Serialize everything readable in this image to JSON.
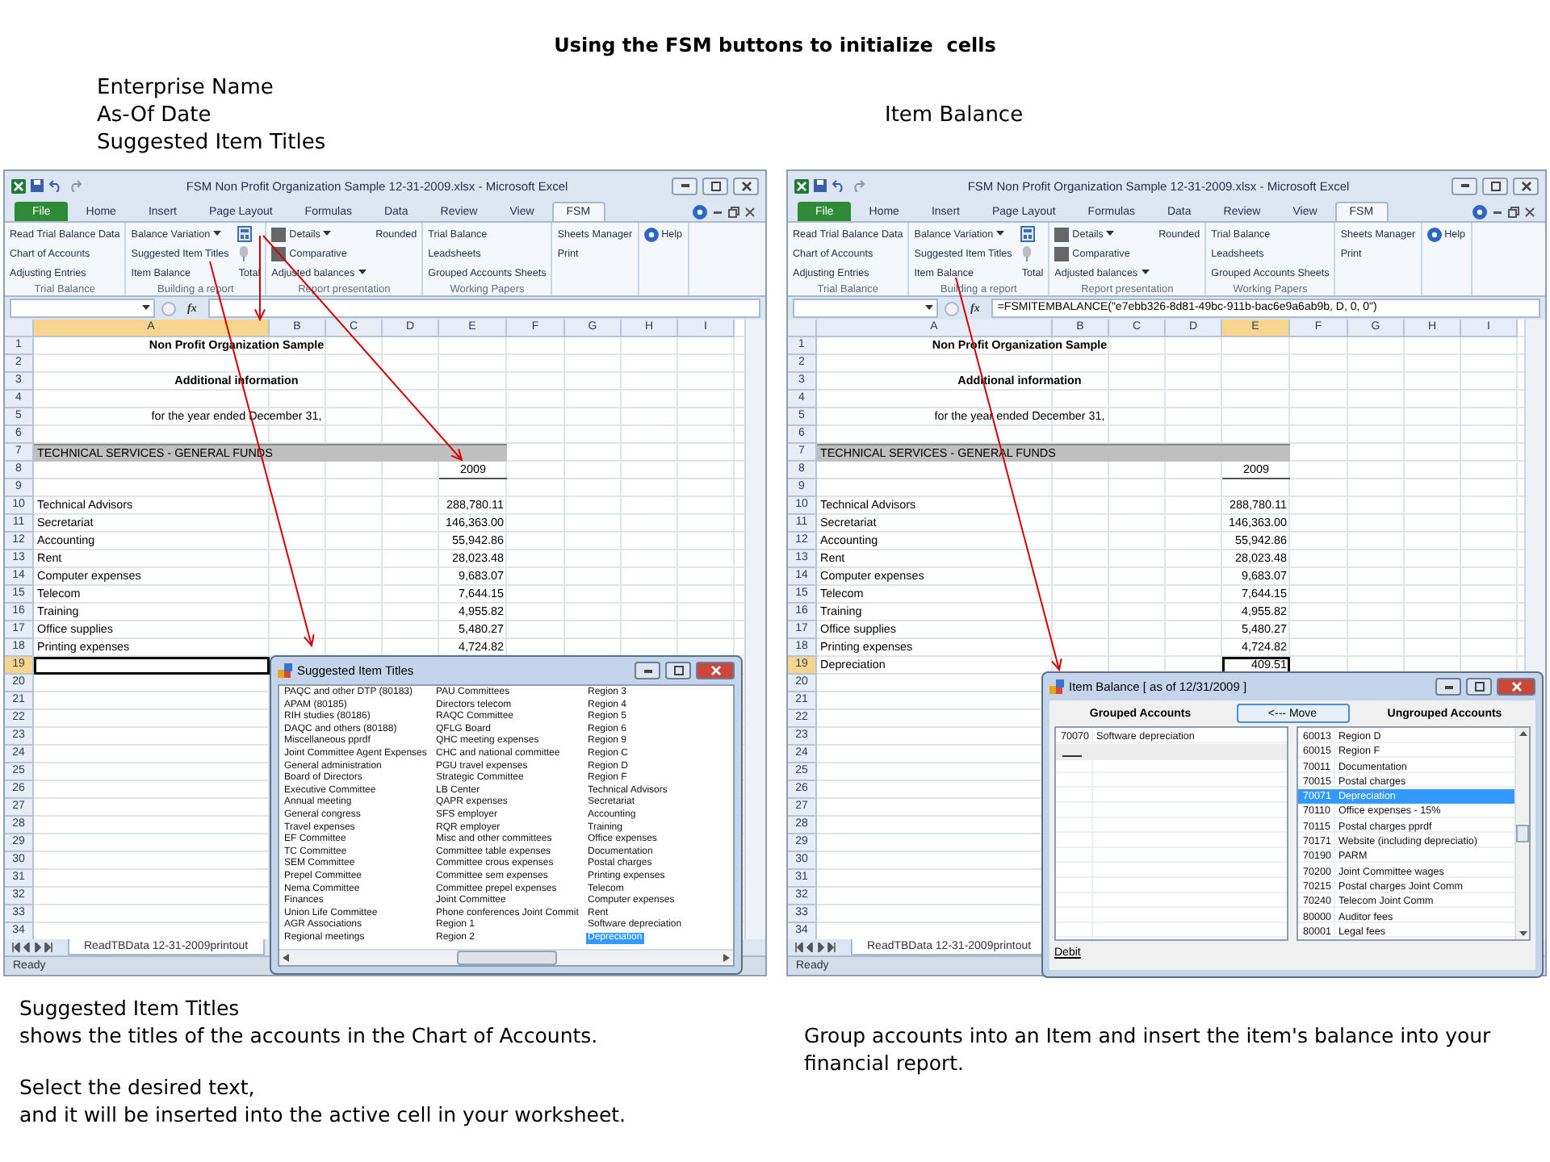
{
  "heading": "Using the FSM buttons to initialize  cells",
  "callouts": {
    "left": [
      "Enterprise Name",
      "As-Of Date",
      "Suggested Item Titles"
    ],
    "right": [
      "Item Balance"
    ]
  },
  "windows": [
    {
      "title": "FSM Non Profit Organization Sample 12-31-2009.xlsx  -  Microsoft Excel",
      "tabs": [
        {
          "label": "File",
          "kind": "file",
          "selected": false
        },
        {
          "label": "Home",
          "kind": "tab",
          "selected": false
        },
        {
          "label": "Insert",
          "kind": "tab",
          "selected": false
        },
        {
          "label": "Page Layout",
          "kind": "tab",
          "selected": false
        },
        {
          "label": "Formulas",
          "kind": "tab",
          "selected": false
        },
        {
          "label": "Data",
          "kind": "tab",
          "selected": false
        },
        {
          "label": "Review",
          "kind": "tab",
          "selected": false
        },
        {
          "label": "View",
          "kind": "tab",
          "selected": false
        },
        {
          "label": "FSM",
          "kind": "tab",
          "selected": true
        }
      ],
      "ribbon": [
        {
          "label": "Trial Balance",
          "columns": [
            [
              {
                "kind": "text",
                "label": "Read Trial Balance Data"
              },
              {
                "kind": "text",
                "label": "Chart of Accounts"
              },
              {
                "kind": "text",
                "label": "Adjusting Entries"
              }
            ]
          ]
        },
        {
          "label": "Building a report",
          "columns": [
            [
              {
                "kind": "dropdown",
                "label": "Balance Variation"
              },
              {
                "kind": "text",
                "label": "Suggested Item Titles"
              },
              {
                "kind": "text",
                "label": "Item Balance"
              }
            ],
            [
              {
                "kind": "calculator"
              },
              {
                "kind": "pin"
              },
              {
                "kind": "text",
                "label": "Total"
              }
            ]
          ]
        },
        {
          "label": "Report presentation",
          "columns": [
            [
              {
                "kind": "swatch-dropdown",
                "label": "Details"
              },
              {
                "kind": "swatch",
                "label": "Comparative"
              },
              {
                "kind": "dropdown",
                "label": "Adjusted balances"
              }
            ],
            [
              {
                "kind": "text",
                "label": "Rounded"
              }
            ]
          ]
        },
        {
          "label": "Working Papers",
          "columns": [
            [
              {
                "kind": "text",
                "label": "Trial Balance"
              },
              {
                "kind": "text",
                "label": "Leadsheets"
              },
              {
                "kind": "text",
                "label": "Grouped Accounts Sheets"
              }
            ]
          ]
        },
        {
          "columns": [
            [
              {
                "kind": "text",
                "label": "Sheets Manager"
              },
              {
                "kind": "text",
                "label": "Print"
              }
            ]
          ]
        },
        {
          "columns": [
            [
              {
                "kind": "help",
                "label": "Help"
              }
            ]
          ]
        }
      ],
      "formula_bar": {
        "fx": "fx"
      },
      "columns": [
        {
          "label": "A",
          "selected": true
        },
        {
          "label": "B",
          "selected": false
        },
        {
          "label": "C",
          "selected": false
        },
        {
          "label": "D",
          "selected": false
        },
        {
          "label": "E",
          "selected": false
        },
        {
          "label": "F",
          "selected": false
        },
        {
          "label": "G",
          "selected": false
        },
        {
          "label": "H",
          "selected": false
        },
        {
          "label": "I",
          "selected": false
        }
      ],
      "rows": [
        {
          "n": "1",
          "kind": "heading",
          "text": "Non Profit Organization Sample",
          "selected": false
        },
        {
          "n": "2",
          "kind": "blank",
          "selected": false
        },
        {
          "n": "3",
          "kind": "heading",
          "text": "Additional information",
          "selected": false
        },
        {
          "n": "4",
          "kind": "blank",
          "selected": false
        },
        {
          "n": "5",
          "kind": "caption",
          "text": "for the year ended December 31,",
          "selected": false
        },
        {
          "n": "6",
          "kind": "blank",
          "selected": false
        },
        {
          "n": "7",
          "kind": "band",
          "text": "TECHNICAL SERVICES - GENERAL FUNDS",
          "selected": false
        },
        {
          "n": "8",
          "kind": "year",
          "value": "2009",
          "selected": false
        },
        {
          "n": "9",
          "kind": "blank",
          "selected": false
        },
        {
          "n": "10",
          "kind": "item",
          "label": "Technical Advisors",
          "value": "288,780.11",
          "selected": false
        },
        {
          "n": "11",
          "kind": "item",
          "label": "Secretariat",
          "value": "146,363.00",
          "selected": false
        },
        {
          "n": "12",
          "kind": "item",
          "label": "Accounting",
          "value": "55,942.86",
          "selected": false
        },
        {
          "n": "13",
          "kind": "item",
          "label": "Rent",
          "value": "28,023.48",
          "selected": false
        },
        {
          "n": "14",
          "kind": "item",
          "label": "Computer expenses",
          "value": "9,683.07",
          "selected": false
        },
        {
          "n": "15",
          "kind": "item",
          "label": "Telecom",
          "value": "7,644.15",
          "selected": false
        },
        {
          "n": "16",
          "kind": "item",
          "label": "Training",
          "value": "4,955.82",
          "selected": false
        },
        {
          "n": "17",
          "kind": "item",
          "label": "Office supplies",
          "value": "5,480.27",
          "selected": false
        },
        {
          "n": "18",
          "kind": "item",
          "label": "Printing expenses",
          "value": "4,724.82",
          "selected": false
        },
        {
          "n": "19",
          "kind": "blank",
          "selected": true
        },
        {
          "n": "20",
          "kind": "blank",
          "selected": false
        },
        {
          "n": "21",
          "kind": "blank",
          "selected": false
        },
        {
          "n": "22",
          "kind": "blank",
          "selected": false
        },
        {
          "n": "23",
          "kind": "blank",
          "selected": false
        },
        {
          "n": "24",
          "kind": "blank",
          "selected": false
        },
        {
          "n": "25",
          "kind": "blank",
          "selected": false
        },
        {
          "n": "26",
          "kind": "blank",
          "selected": false
        },
        {
          "n": "27",
          "kind": "blank",
          "selected": false
        },
        {
          "n": "28",
          "kind": "blank",
          "selected": false
        },
        {
          "n": "29",
          "kind": "blank",
          "selected": false
        },
        {
          "n": "30",
          "kind": "blank",
          "selected": false
        },
        {
          "n": "31",
          "kind": "blank",
          "selected": false
        },
        {
          "n": "32",
          "kind": "blank",
          "selected": false
        },
        {
          "n": "33",
          "kind": "blank",
          "selected": false
        },
        {
          "n": "34",
          "kind": "blank",
          "selected": false
        }
      ],
      "sheet_tab": "ReadTBData 12-31-2009printout",
      "status": "Ready",
      "dialog": {
        "kind": "titles",
        "title": "Suggested Item Titles",
        "columns": [
          [
            {
              "label": "PAQC and other DTP (80183)",
              "selected": false
            },
            {
              "label": "APAM (80185)",
              "selected": false
            },
            {
              "label": "RIH studies (80186)",
              "selected": false
            },
            {
              "label": "DAQC and others (80188)",
              "selected": false
            },
            {
              "label": "Miscellaneous pprdf",
              "selected": false
            },
            {
              "label": "Joint Committee Agent Expenses",
              "selected": false
            },
            {
              "label": "General administration",
              "selected": false
            },
            {
              "label": "Board of Directors",
              "selected": false
            },
            {
              "label": "Executive Committee",
              "selected": false
            },
            {
              "label": "Annual meeting",
              "selected": false
            },
            {
              "label": "General congress",
              "selected": false
            },
            {
              "label": "Travel expenses",
              "selected": false
            },
            {
              "label": "EF Committee",
              "selected": false
            },
            {
              "label": "TC Committee",
              "selected": false
            },
            {
              "label": "SEM Committee",
              "selected": false
            },
            {
              "label": "Prepel Committee",
              "selected": false
            },
            {
              "label": "Nema Committee",
              "selected": false
            },
            {
              "label": "Finances",
              "selected": false
            },
            {
              "label": "Union Life Committee",
              "selected": false
            },
            {
              "label": "AGR Associations",
              "selected": false
            },
            {
              "label": "Regional meetings",
              "selected": false
            }
          ],
          [
            {
              "label": "PAU Committees",
              "selected": false
            },
            {
              "label": "Directors telecom",
              "selected": false
            },
            {
              "label": "RAQC Committee",
              "selected": false
            },
            {
              "label": "QFLG Board",
              "selected": false
            },
            {
              "label": "QHC meeting expenses",
              "selected": false
            },
            {
              "label": "CHC and national committee",
              "selected": false
            },
            {
              "label": "PGU travel expenses",
              "selected": false
            },
            {
              "label": "Strategic Committee",
              "selected": false
            },
            {
              "label": "LB Center",
              "selected": false
            },
            {
              "label": "QAPR expenses",
              "selected": false
            },
            {
              "label": "SFS employer",
              "selected": false
            },
            {
              "label": "RQR employer",
              "selected": false
            },
            {
              "label": "Misc and other committees",
              "selected": false
            },
            {
              "label": "Committee table expenses",
              "selected": false
            },
            {
              "label": "Committee crous expenses",
              "selected": false
            },
            {
              "label": "Committee sem expenses",
              "selected": false
            },
            {
              "label": "Committee prepel expenses",
              "selected": false
            },
            {
              "label": "Joint Committee",
              "selected": false
            },
            {
              "label": "Phone conferences Joint Commit",
              "selected": false
            },
            {
              "label": "Region 1",
              "selected": false
            },
            {
              "label": "Region 2",
              "selected": false
            }
          ],
          [
            {
              "label": "Region 3",
              "selected": false
            },
            {
              "label": "Region 4",
              "selected": false
            },
            {
              "label": "Region 5",
              "selected": false
            },
            {
              "label": "Region 6",
              "selected": false
            },
            {
              "label": "Region 9",
              "selected": false
            },
            {
              "label": "Region C",
              "selected": false
            },
            {
              "label": "Region D",
              "selected": false
            },
            {
              "label": "Region F",
              "selected": false
            },
            {
              "label": "Technical Advisors",
              "selected": false
            },
            {
              "label": "Secretariat",
              "selected": false
            },
            {
              "label": "Accounting",
              "selected": false
            },
            {
              "label": "Training",
              "selected": false
            },
            {
              "label": "Office expenses",
              "selected": false
            },
            {
              "label": "Documentation",
              "selected": false
            },
            {
              "label": "Postal charges",
              "selected": false
            },
            {
              "label": "Printing expenses",
              "selected": false
            },
            {
              "label": "Telecom",
              "selected": false
            },
            {
              "label": "Computer expenses",
              "selected": false
            },
            {
              "label": "Rent",
              "selected": false
            },
            {
              "label": "Software depreciation",
              "selected": false
            },
            {
              "label": "Depreciation",
              "selected": true
            }
          ]
        ]
      }
    },
    {
      "title": "FSM Non Profit Organization Sample 12-31-2009.xlsx  -  Microsoft Excel",
      "tabs": [
        {
          "label": "File",
          "kind": "file",
          "selected": false
        },
        {
          "label": "Home",
          "kind": "tab",
          "selected": false
        },
        {
          "label": "Insert",
          "kind": "tab",
          "selected": false
        },
        {
          "label": "Page Layout",
          "kind": "tab",
          "selected": false
        },
        {
          "label": "Formulas",
          "kind": "tab",
          "selected": false
        },
        {
          "label": "Data",
          "kind": "tab",
          "selected": false
        },
        {
          "label": "Review",
          "kind": "tab",
          "selected": false
        },
        {
          "label": "View",
          "kind": "tab",
          "selected": false
        },
        {
          "label": "FSM",
          "kind": "tab",
          "selected": true
        }
      ],
      "ribbon": [
        {
          "label": "Trial Balance",
          "columns": [
            [
              {
                "kind": "text",
                "label": "Read Trial Balance Data"
              },
              {
                "kind": "text",
                "label": "Chart of Accounts"
              },
              {
                "kind": "text",
                "label": "Adjusting Entries"
              }
            ]
          ]
        },
        {
          "label": "Building a report",
          "columns": [
            [
              {
                "kind": "dropdown",
                "label": "Balance Variation"
              },
              {
                "kind": "text",
                "label": "Suggested Item Titles"
              },
              {
                "kind": "text",
                "label": "Item Balance"
              }
            ],
            [
              {
                "kind": "calculator"
              },
              {
                "kind": "pin"
              },
              {
                "kind": "text",
                "label": "Total"
              }
            ]
          ]
        },
        {
          "label": "Report presentation",
          "columns": [
            [
              {
                "kind": "swatch-dropdown",
                "label": "Details"
              },
              {
                "kind": "swatch",
                "label": "Comparative"
              },
              {
                "kind": "dropdown",
                "label": "Adjusted balances"
              }
            ],
            [
              {
                "kind": "text",
                "label": "Rounded"
              }
            ]
          ]
        },
        {
          "label": "Working Papers",
          "columns": [
            [
              {
                "kind": "text",
                "label": "Trial Balance"
              },
              {
                "kind": "text",
                "label": "Leadsheets"
              },
              {
                "kind": "text",
                "label": "Grouped Accounts Sheets"
              }
            ]
          ]
        },
        {
          "columns": [
            [
              {
                "kind": "text",
                "label": "Sheets Manager"
              },
              {
                "kind": "text",
                "label": "Print"
              }
            ]
          ]
        },
        {
          "columns": [
            [
              {
                "kind": "help",
                "label": "Help"
              }
            ]
          ]
        }
      ],
      "formula_bar": {
        "fx": "fx",
        "formula": "=FSMITEMBALANCE(\"e7ebb326-8d81-49bc-911b-bac6e9a6ab9b, D, 0, 0\")"
      },
      "columns": [
        {
          "label": "A",
          "selected": false
        },
        {
          "label": "B",
          "selected": false
        },
        {
          "label": "C",
          "selected": false
        },
        {
          "label": "D",
          "selected": false
        },
        {
          "label": "E",
          "selected": true
        },
        {
          "label": "F",
          "selected": false
        },
        {
          "label": "G",
          "selected": false
        },
        {
          "label": "H",
          "selected": false
        },
        {
          "label": "I",
          "selected": false
        }
      ],
      "rows": [
        {
          "n": "1",
          "kind": "heading",
          "text": "Non Profit Organization Sample",
          "selected": false
        },
        {
          "n": "2",
          "kind": "blank",
          "selected": false
        },
        {
          "n": "3",
          "kind": "heading",
          "text": "Additional information",
          "selected": false
        },
        {
          "n": "4",
          "kind": "blank",
          "selected": false
        },
        {
          "n": "5",
          "kind": "caption",
          "text": "for the year ended December 31,",
          "selected": false
        },
        {
          "n": "6",
          "kind": "blank",
          "selected": false
        },
        {
          "n": "7",
          "kind": "band",
          "text": "TECHNICAL SERVICES - GENERAL FUNDS",
          "selected": false
        },
        {
          "n": "8",
          "kind": "year",
          "value": "2009",
          "selected": false
        },
        {
          "n": "9",
          "kind": "blank",
          "selected": false
        },
        {
          "n": "10",
          "kind": "item",
          "label": "Technical Advisors",
          "value": "288,780.11",
          "selected": false
        },
        {
          "n": "11",
          "kind": "item",
          "label": "Secretariat",
          "value": "146,363.00",
          "selected": false
        },
        {
          "n": "12",
          "kind": "item",
          "label": "Accounting",
          "value": "55,942.86",
          "selected": false
        },
        {
          "n": "13",
          "kind": "item",
          "label": "Rent",
          "value": "28,023.48",
          "selected": false
        },
        {
          "n": "14",
          "kind": "item",
          "label": "Computer expenses",
          "value": "9,683.07",
          "selected": false
        },
        {
          "n": "15",
          "kind": "item",
          "label": "Telecom",
          "value": "7,644.15",
          "selected": false
        },
        {
          "n": "16",
          "kind": "item",
          "label": "Training",
          "value": "4,955.82",
          "selected": false
        },
        {
          "n": "17",
          "kind": "item",
          "label": "Office supplies",
          "value": "5,480.27",
          "selected": false
        },
        {
          "n": "18",
          "kind": "item",
          "label": "Printing expenses",
          "value": "4,724.82",
          "selected": false
        },
        {
          "n": "19",
          "kind": "item",
          "label": "Depreciation",
          "value": "409.51",
          "selected": true
        },
        {
          "n": "20",
          "kind": "blank",
          "selected": false
        },
        {
          "n": "21",
          "kind": "blank",
          "selected": false
        },
        {
          "n": "22",
          "kind": "blank",
          "selected": false
        },
        {
          "n": "23",
          "kind": "blank",
          "selected": false
        },
        {
          "n": "24",
          "kind": "blank",
          "selected": false
        },
        {
          "n": "25",
          "kind": "blank",
          "selected": false
        },
        {
          "n": "26",
          "kind": "blank",
          "selected": false
        },
        {
          "n": "27",
          "kind": "blank",
          "selected": false
        },
        {
          "n": "28",
          "kind": "blank",
          "selected": false
        },
        {
          "n": "29",
          "kind": "blank",
          "selected": false
        },
        {
          "n": "30",
          "kind": "blank",
          "selected": false
        },
        {
          "n": "31",
          "kind": "blank",
          "selected": false
        },
        {
          "n": "32",
          "kind": "blank",
          "selected": false
        },
        {
          "n": "33",
          "kind": "blank",
          "selected": false
        },
        {
          "n": "34",
          "kind": "blank",
          "selected": false
        }
      ],
      "sheet_tab": "ReadTBData 12-31-2009printout",
      "status": "Ready",
      "dialog": {
        "kind": "balance",
        "title": "Item Balance [ as of 12/31/2009 ]",
        "grouped_label": "Grouped Accounts",
        "move_button": "<--- Move",
        "ungrouped_label": "Ungrouped Accounts",
        "grouped": [
          {
            "code": "70070",
            "name": "Software depreciation"
          }
        ],
        "new_row": true,
        "ungrouped": [
          {
            "code": "60013",
            "name": "Region D",
            "selected": false
          },
          {
            "code": "60015",
            "name": "Region F",
            "selected": false
          },
          {
            "code": "70011",
            "name": "Documentation",
            "selected": false
          },
          {
            "code": "70015",
            "name": "Postal charges",
            "selected": false
          },
          {
            "code": "70071",
            "name": "Depreciation",
            "selected": true
          },
          {
            "code": "70110",
            "name": "Office expenses - 15%",
            "selected": false
          },
          {
            "code": "70115",
            "name": "Postal charges pprdf",
            "selected": false
          },
          {
            "code": "70171",
            "name": "Website (including depreciatio)",
            "selected": false
          },
          {
            "code": "70190",
            "name": "PARM",
            "selected": false
          },
          {
            "code": "70200",
            "name": "Joint Committee wages",
            "selected": false
          },
          {
            "code": "70215",
            "name": "Postal charges Joint Comm",
            "selected": false
          },
          {
            "code": "70240",
            "name": "Telecom Joint Comm",
            "selected": false
          },
          {
            "code": "80000",
            "name": "Auditor fees",
            "selected": false
          },
          {
            "code": "80001",
            "name": "Legal fees",
            "selected": false
          }
        ],
        "link": "Debit"
      }
    }
  ],
  "notes": {
    "left": [
      [
        "Suggested Item Titles",
        "shows the titles of the accounts in the Chart of Accounts."
      ],
      [
        "Select the desired text,",
        "and it will be inserted into the active cell in your worksheet."
      ]
    ],
    "right": [
      "Group accounts into an Item and insert the item's balance into your financial report."
    ]
  }
}
